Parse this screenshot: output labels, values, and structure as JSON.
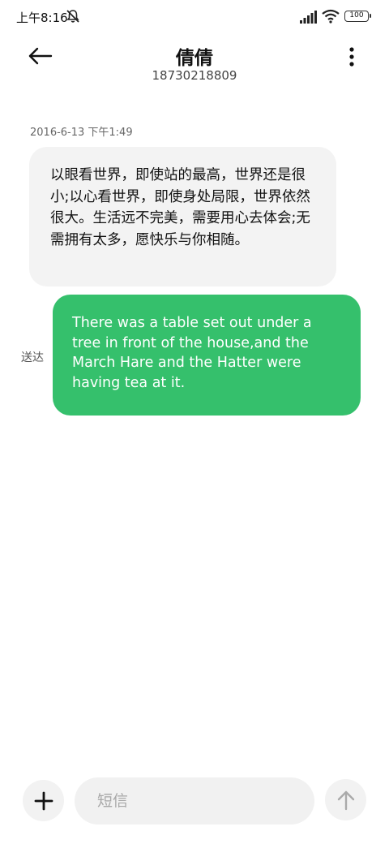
{
  "status_bar": {
    "time": "上午8:16",
    "battery": "100",
    "icons": [
      "mute-icon",
      "signal-icon",
      "wifi-icon",
      "battery-icon"
    ]
  },
  "header": {
    "back_icon": "arrow-left-icon",
    "contact_name": "倩倩",
    "contact_number": "18730218809",
    "more_icon": "more-vertical-icon"
  },
  "conversation": {
    "timestamp": "2016-6-13 下午1:49",
    "messages": [
      {
        "direction": "incoming",
        "text": "以眼看世界，即使站的最高，世界还是很小;以心看世界，即使身处局限，世界依然很大。生活远不完美，需要用心去体会;无需拥有太多，愿快乐与你相随。"
      },
      {
        "direction": "outgoing",
        "status": "送达",
        "text": "There was a table set out under a tree in front of the house,and the March Hare and the Hatter were having tea at it."
      }
    ]
  },
  "composer": {
    "add_icon": "plus-icon",
    "placeholder": "短信",
    "value": "",
    "send_icon": "arrow-up-icon"
  },
  "colors": {
    "outgoing_bubble": "#35c06c",
    "incoming_bubble": "#f3f3f3",
    "background": "#ffffff"
  }
}
